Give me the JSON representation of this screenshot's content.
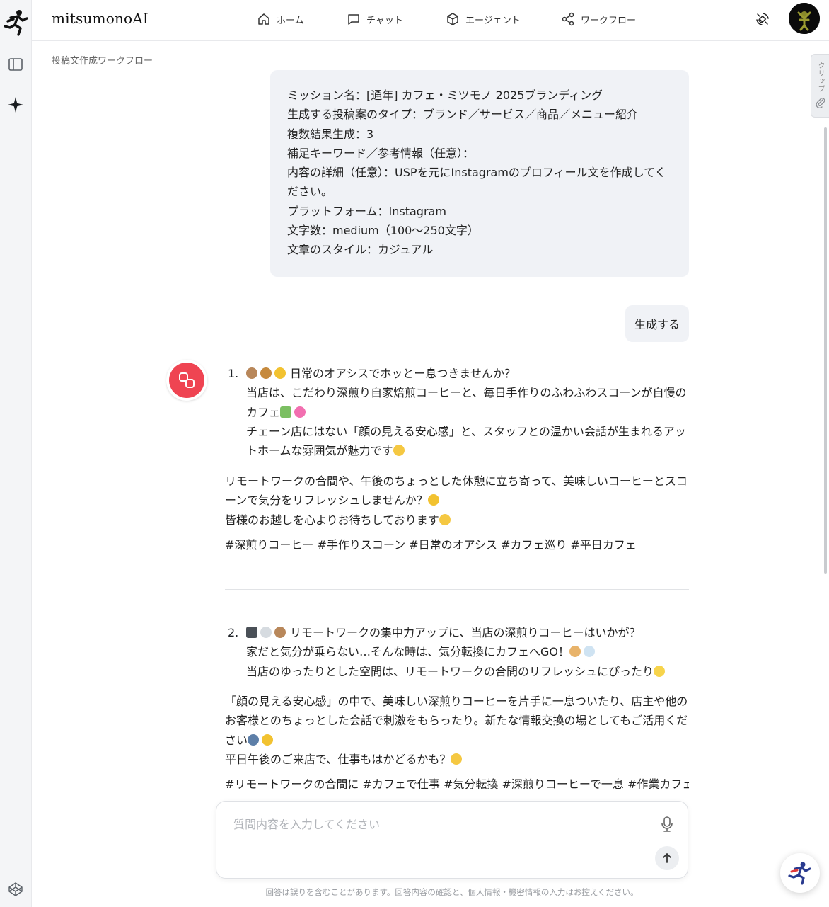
{
  "app": {
    "brand": "mitsumonoAI"
  },
  "nav": {
    "home": "ホーム",
    "chat": "チャット",
    "agent": "エージェント",
    "workflow": "ワークフロー"
  },
  "breadcrumb": "投稿文作成ワークフロー",
  "clip_tab": "クリップ",
  "mission": {
    "lines": [
      "ミッション名：[通年] カフェ・ミツモノ 2025ブランディング",
      "生成する投稿案のタイプ：ブランド／サービス／商品／メニュー紹介",
      "複数結果生成：3",
      "補足キーワード／参考情報（任意）：",
      "内容の詳細（任意）：USPを元にInstagramのプロフィール文を作成してください。",
      "プラットフォーム：Instagram",
      "文字数：medium（100〜250文字）",
      "文章のスタイル：カジュアル"
    ]
  },
  "generate_message": "生成する",
  "response": {
    "item1": {
      "number": "1.",
      "line1": "日常のオアシスでホッとー息つきませんか？",
      "line2": "当店は、こだわり深煎り自家焙煎コーヒーと、毎日手作りのふわふわスコーンが自慢のカフェ",
      "line3": "チェーン店にはない「顔の見える安心感」と、スタッフとの温かい会話が生まれるアットホームな雰囲気が魅力です",
      "para1": "リモートワークの合間や、午後のちょっとした休憩に立ち寄って、美味しいコーヒーとスコーンで気分をリフレッシュしませんか？",
      "para2": "皆様のお越しを心よりお待ちしております",
      "hashtags": "#深煎りコーヒー #手作りスコーン #日常のオアシス #カフェ巡り #平日カフェ"
    },
    "item2": {
      "number": "2.",
      "line1": "リモートワークの集中力アップに、当店の深煎りコーヒーはいかが？",
      "line2": "家だと気分が乗らない…そんな時は、気分転換にカフェへGO！",
      "line3": "当店のゆったりとした空間は、リモートワークの合間のリフレッシュにぴったり",
      "para1": "「顔の見える安心感」の中で、美味しい深煎りコーヒーを片手に一息ついたり、店主や他のお客様とのちょっとした会話で刺激をもらったり。新たな情報交換の場としてもご活用ください",
      "para2": "平日午後のご来店で、仕事もはかどるかも？",
      "hashtags": "#リモートワークの合間に #カフェで仕事 #気分転換 #深煎りコーヒーで一息 #作業カフェ"
    }
  },
  "input": {
    "placeholder": "質問内容を入力してください",
    "value": ""
  },
  "disclaimer": "回答は誤りを含むことがあります。回答内容の確認と、個人情報・機密情報の入力はお控えください。",
  "colors": {
    "accent_red": "#ef4452",
    "bubble_bg": "#f0f2f6",
    "rail_bg": "#f4f5f7"
  },
  "icons": [
    "runner-logo-icon",
    "sidebar-toggle-icon",
    "sparkle-icon",
    "codepen-icon",
    "home-icon",
    "chat-icon",
    "agent-box-icon",
    "workflow-share-icon",
    "satellite-icon",
    "paperclip-icon",
    "microphone-icon",
    "arrow-up-icon",
    "ai-bot-icon"
  ]
}
